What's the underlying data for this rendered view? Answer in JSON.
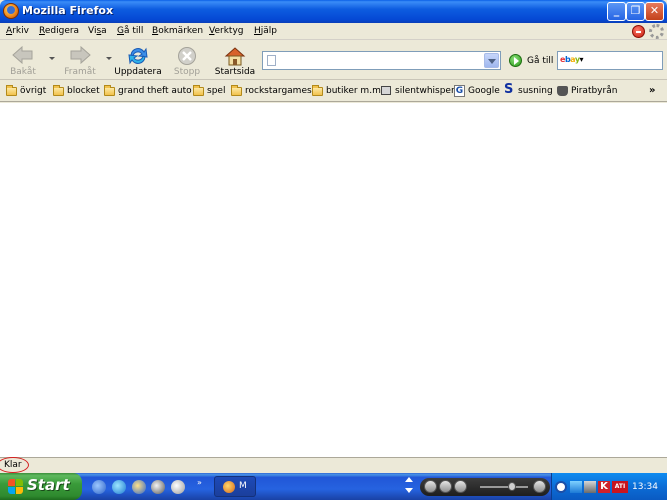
{
  "window": {
    "title": "Mozilla Firefox",
    "min_label": "_",
    "max_label": "❐",
    "close_label": "✕"
  },
  "menu": [
    {
      "label": "Arkiv",
      "u": "A",
      "rest": "rkiv"
    },
    {
      "label": "Redigera",
      "u": "R",
      "rest": "edigera"
    },
    {
      "label": "Visa",
      "pre": "Vi",
      "u": "s",
      "rest": "a"
    },
    {
      "label": "Gå till",
      "u": "G",
      "rest": "å till"
    },
    {
      "label": "Bokmärken",
      "u": "B",
      "rest": "okmärken"
    },
    {
      "label": "Verktyg",
      "u": "V",
      "rest": "erktyg"
    },
    {
      "label": "Hjälp",
      "u": "H",
      "rest": "jälp"
    }
  ],
  "nav": {
    "back": "Bakåt",
    "forward": "Framåt",
    "reload": "Uppdatera",
    "stop": "Stopp",
    "home": "Startsida",
    "url_value": "",
    "go": "Gå till"
  },
  "search": {
    "engine": "ebay"
  },
  "bookmarks": [
    {
      "label": "övrigt",
      "icon": "folder-icon"
    },
    {
      "label": "blocket",
      "icon": "folder-icon"
    },
    {
      "label": "grand theft auto",
      "icon": "folder-icon"
    },
    {
      "label": "spel",
      "icon": "folder-icon"
    },
    {
      "label": "rockstargames",
      "icon": "folder-icon"
    },
    {
      "label": "butiker m.m",
      "icon": "folder-icon"
    },
    {
      "label": "silentwhisper",
      "icon": "computer-icon"
    },
    {
      "label": "Google",
      "icon": "google-icon"
    },
    {
      "label": "susning",
      "icon": "susning-icon"
    },
    {
      "label": "Piratbyrån",
      "icon": "ship-icon"
    }
  ],
  "bookmarks_more": "»",
  "status": {
    "text": "Klar"
  },
  "taskbar": {
    "start": "Start",
    "task_label": "M",
    "clock": "13:34",
    "more": "»"
  },
  "colors": {
    "title_blue": "#0548d4",
    "start_green": "#3a9b3a",
    "chrome": "#ece9d8"
  }
}
